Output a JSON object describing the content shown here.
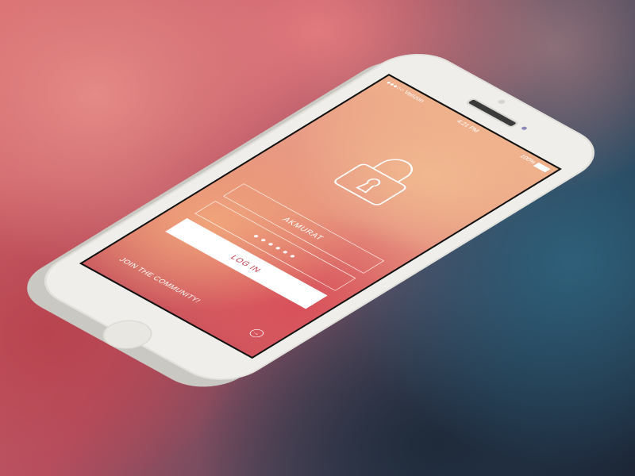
{
  "status_bar": {
    "carrier": "●●●○○ Verizon",
    "time": "4:21 PM",
    "battery": "100%"
  },
  "login": {
    "username": "AKMURAT",
    "password": "● ● ● ● ● ●",
    "button": "LOG IN"
  },
  "join": {
    "label": "JOIN THE COMMUNITY!",
    "arrow": "→"
  },
  "colors": {
    "accent": "#c0313d",
    "device": "#efeeea"
  }
}
